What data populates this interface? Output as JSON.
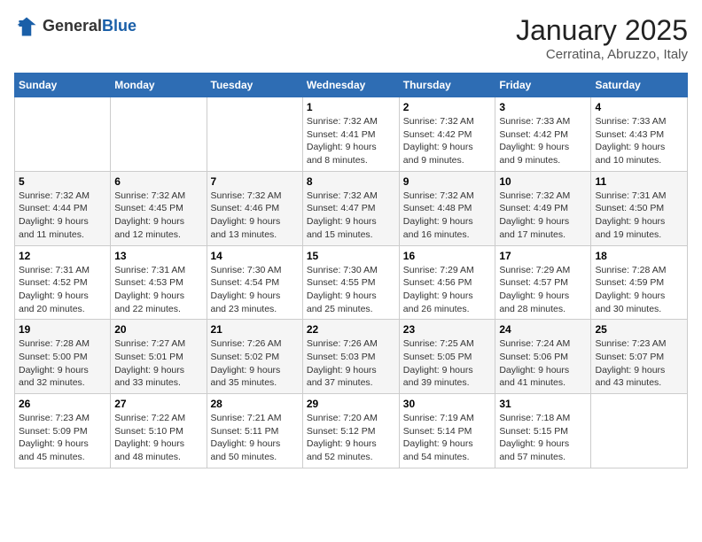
{
  "logo": {
    "general": "General",
    "blue": "Blue"
  },
  "header": {
    "month": "January 2025",
    "location": "Cerratina, Abruzzo, Italy"
  },
  "weekdays": [
    "Sunday",
    "Monday",
    "Tuesday",
    "Wednesday",
    "Thursday",
    "Friday",
    "Saturday"
  ],
  "weeks": [
    [
      {
        "day": "",
        "detail": ""
      },
      {
        "day": "",
        "detail": ""
      },
      {
        "day": "",
        "detail": ""
      },
      {
        "day": "1",
        "detail": "Sunrise: 7:32 AM\nSunset: 4:41 PM\nDaylight: 9 hours\nand 8 minutes."
      },
      {
        "day": "2",
        "detail": "Sunrise: 7:32 AM\nSunset: 4:42 PM\nDaylight: 9 hours\nand 9 minutes."
      },
      {
        "day": "3",
        "detail": "Sunrise: 7:33 AM\nSunset: 4:42 PM\nDaylight: 9 hours\nand 9 minutes."
      },
      {
        "day": "4",
        "detail": "Sunrise: 7:33 AM\nSunset: 4:43 PM\nDaylight: 9 hours\nand 10 minutes."
      }
    ],
    [
      {
        "day": "5",
        "detail": "Sunrise: 7:32 AM\nSunset: 4:44 PM\nDaylight: 9 hours\nand 11 minutes."
      },
      {
        "day": "6",
        "detail": "Sunrise: 7:32 AM\nSunset: 4:45 PM\nDaylight: 9 hours\nand 12 minutes."
      },
      {
        "day": "7",
        "detail": "Sunrise: 7:32 AM\nSunset: 4:46 PM\nDaylight: 9 hours\nand 13 minutes."
      },
      {
        "day": "8",
        "detail": "Sunrise: 7:32 AM\nSunset: 4:47 PM\nDaylight: 9 hours\nand 15 minutes."
      },
      {
        "day": "9",
        "detail": "Sunrise: 7:32 AM\nSunset: 4:48 PM\nDaylight: 9 hours\nand 16 minutes."
      },
      {
        "day": "10",
        "detail": "Sunrise: 7:32 AM\nSunset: 4:49 PM\nDaylight: 9 hours\nand 17 minutes."
      },
      {
        "day": "11",
        "detail": "Sunrise: 7:31 AM\nSunset: 4:50 PM\nDaylight: 9 hours\nand 19 minutes."
      }
    ],
    [
      {
        "day": "12",
        "detail": "Sunrise: 7:31 AM\nSunset: 4:52 PM\nDaylight: 9 hours\nand 20 minutes."
      },
      {
        "day": "13",
        "detail": "Sunrise: 7:31 AM\nSunset: 4:53 PM\nDaylight: 9 hours\nand 22 minutes."
      },
      {
        "day": "14",
        "detail": "Sunrise: 7:30 AM\nSunset: 4:54 PM\nDaylight: 9 hours\nand 23 minutes."
      },
      {
        "day": "15",
        "detail": "Sunrise: 7:30 AM\nSunset: 4:55 PM\nDaylight: 9 hours\nand 25 minutes."
      },
      {
        "day": "16",
        "detail": "Sunrise: 7:29 AM\nSunset: 4:56 PM\nDaylight: 9 hours\nand 26 minutes."
      },
      {
        "day": "17",
        "detail": "Sunrise: 7:29 AM\nSunset: 4:57 PM\nDaylight: 9 hours\nand 28 minutes."
      },
      {
        "day": "18",
        "detail": "Sunrise: 7:28 AM\nSunset: 4:59 PM\nDaylight: 9 hours\nand 30 minutes."
      }
    ],
    [
      {
        "day": "19",
        "detail": "Sunrise: 7:28 AM\nSunset: 5:00 PM\nDaylight: 9 hours\nand 32 minutes."
      },
      {
        "day": "20",
        "detail": "Sunrise: 7:27 AM\nSunset: 5:01 PM\nDaylight: 9 hours\nand 33 minutes."
      },
      {
        "day": "21",
        "detail": "Sunrise: 7:26 AM\nSunset: 5:02 PM\nDaylight: 9 hours\nand 35 minutes."
      },
      {
        "day": "22",
        "detail": "Sunrise: 7:26 AM\nSunset: 5:03 PM\nDaylight: 9 hours\nand 37 minutes."
      },
      {
        "day": "23",
        "detail": "Sunrise: 7:25 AM\nSunset: 5:05 PM\nDaylight: 9 hours\nand 39 minutes."
      },
      {
        "day": "24",
        "detail": "Sunrise: 7:24 AM\nSunset: 5:06 PM\nDaylight: 9 hours\nand 41 minutes."
      },
      {
        "day": "25",
        "detail": "Sunrise: 7:23 AM\nSunset: 5:07 PM\nDaylight: 9 hours\nand 43 minutes."
      }
    ],
    [
      {
        "day": "26",
        "detail": "Sunrise: 7:23 AM\nSunset: 5:09 PM\nDaylight: 9 hours\nand 45 minutes."
      },
      {
        "day": "27",
        "detail": "Sunrise: 7:22 AM\nSunset: 5:10 PM\nDaylight: 9 hours\nand 48 minutes."
      },
      {
        "day": "28",
        "detail": "Sunrise: 7:21 AM\nSunset: 5:11 PM\nDaylight: 9 hours\nand 50 minutes."
      },
      {
        "day": "29",
        "detail": "Sunrise: 7:20 AM\nSunset: 5:12 PM\nDaylight: 9 hours\nand 52 minutes."
      },
      {
        "day": "30",
        "detail": "Sunrise: 7:19 AM\nSunset: 5:14 PM\nDaylight: 9 hours\nand 54 minutes."
      },
      {
        "day": "31",
        "detail": "Sunrise: 7:18 AM\nSunset: 5:15 PM\nDaylight: 9 hours\nand 57 minutes."
      },
      {
        "day": "",
        "detail": ""
      }
    ]
  ]
}
